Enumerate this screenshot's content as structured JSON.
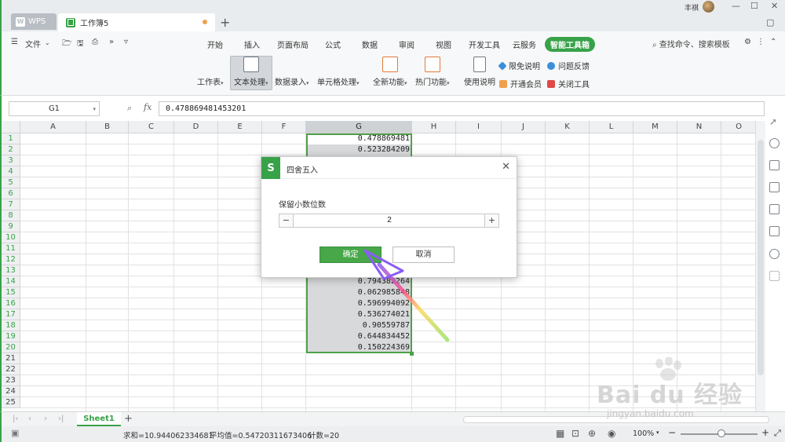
{
  "titlebar": {
    "wps_tab": "WPS",
    "doc_tab": "工作簿5",
    "new_tab": "+",
    "user_name": "丰祺"
  },
  "toolbar": {
    "file_menu": "文件",
    "menu_tabs": [
      "开始",
      "插入",
      "页面布局",
      "公式",
      "数据",
      "审阅",
      "视图",
      "开发工具",
      "云服务",
      "智能工具箱"
    ],
    "active_tab_index": 9,
    "search_placeholder": "查找命令、搜索模板",
    "ribbon_buttons": [
      "工作表",
      "文本处理",
      "数据录入",
      "单元格处理",
      "全新功能",
      "热门功能",
      "使用说明"
    ],
    "selected_ribbon_index": 1,
    "small_tools": [
      "限免说明",
      "问题反馈",
      "开通会员",
      "关闭工具"
    ]
  },
  "formula": {
    "cell_ref": "G1",
    "fx": "fx",
    "value": "0.478869481453201"
  },
  "grid": {
    "columns": [
      "A",
      "B",
      "C",
      "D",
      "E",
      "F",
      "G",
      "H",
      "I",
      "J",
      "K",
      "L",
      "M",
      "N",
      "O"
    ],
    "selected_column": "G",
    "rows": [
      "1",
      "2",
      "3",
      "4",
      "5",
      "6",
      "7",
      "8",
      "9",
      "10",
      "11",
      "12",
      "13",
      "14",
      "15",
      "16",
      "17",
      "18",
      "19",
      "20",
      "21",
      "22",
      "23",
      "24",
      "25"
    ],
    "g_values": [
      {
        "row": 1,
        "value": "0.478869481"
      },
      {
        "row": 2,
        "value": "0.523284209"
      },
      {
        "row": 14,
        "value": "0.794382264"
      },
      {
        "row": 15,
        "value": "0.062985848"
      },
      {
        "row": 16,
        "value": "0.596994092"
      },
      {
        "row": 17,
        "value": "0.536274021"
      },
      {
        "row": 18,
        "value": "0.90559787"
      },
      {
        "row": 19,
        "value": "0.644834452"
      },
      {
        "row": 20,
        "value": "0.150224369"
      }
    ]
  },
  "dialog": {
    "logo": "S",
    "title": "四舍五入",
    "label": "保留小数位数",
    "minus": "−",
    "plus": "+",
    "value": "2",
    "ok": "确定",
    "cancel": "取消"
  },
  "sheets": {
    "tab": "Sheet1",
    "add": "+"
  },
  "status": {
    "sum": "求和=10.944062334681",
    "avg": "平均值=0.54720311673406",
    "count": "计数=20",
    "zoom": "100%"
  },
  "watermark": {
    "brand": "Bai du 经验",
    "url": "jingyan.baidu.com"
  },
  "colors": {
    "accent": "#38a249",
    "selection": "#d8d9db",
    "button_ok": "#47a749"
  }
}
